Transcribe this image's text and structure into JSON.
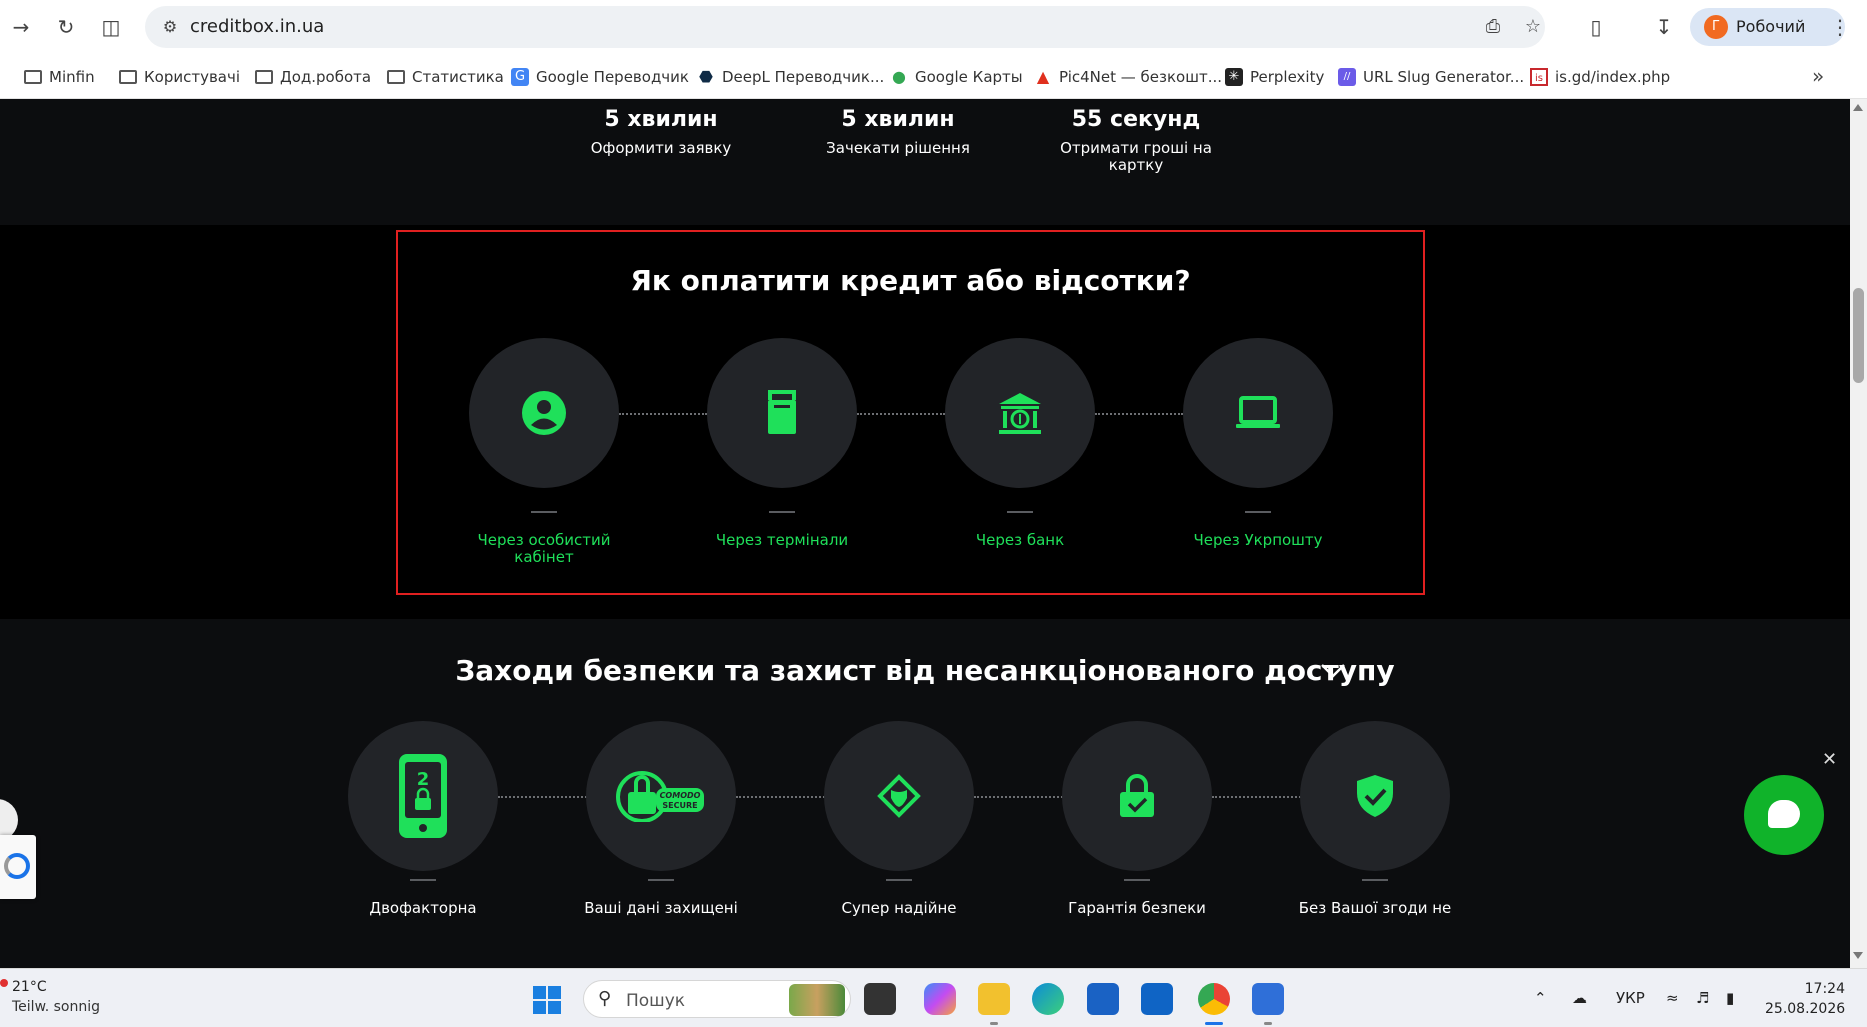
{
  "browser": {
    "url": "creditbox.in.ua",
    "profile_initial": "Г",
    "profile_name": "Робочий",
    "bookmarks": [
      {
        "label": "Minfin",
        "icon": "folder-icon"
      },
      {
        "label": "Користувачі",
        "icon": "folder-icon"
      },
      {
        "label": "Дод.робота",
        "icon": "folder-icon"
      },
      {
        "label": "Статистика",
        "icon": "folder-icon"
      },
      {
        "label": "Google Переводчик",
        "icon": "google-translate-icon"
      },
      {
        "label": "DeepL Переводчик...",
        "icon": "deepl-icon"
      },
      {
        "label": "Google Карты",
        "icon": "maps-pin-icon"
      },
      {
        "label": "Pic4Net — безкошт...",
        "icon": "pic4net-icon"
      },
      {
        "label": "Perplexity",
        "icon": "perplexity-icon"
      },
      {
        "label": "URL Slug Generator...",
        "icon": "url-slug-icon"
      },
      {
        "label": "is.gd/index.php",
        "icon": "isgd-icon"
      }
    ]
  },
  "stats": [
    {
      "value": "5 хвилин",
      "label": "Оформити заявку"
    },
    {
      "value": "5 хвилин",
      "label": "Зачекати рішення"
    },
    {
      "value": "55 секунд",
      "label": "Отримати гроші на картку"
    }
  ],
  "payment": {
    "title": "Як оплатити кредит або відсотки?",
    "steps": [
      {
        "label": "Через особистий кабінет",
        "icon": "user-account-icon"
      },
      {
        "label": "Через термінали",
        "icon": "terminal-icon"
      },
      {
        "label": "Через банк",
        "icon": "bank-icon"
      },
      {
        "label": "Через Укрпошту",
        "icon": "laptop-icon"
      }
    ]
  },
  "security": {
    "title": "Заходи безпеки та захист від несанкціонованого доступу",
    "items": [
      {
        "label": "Двофакторна",
        "icon": "phone-2fa-icon"
      },
      {
        "label": "Ваші дані захищені",
        "icon": "comodo-secure-icon",
        "badge_line1": "COMODO",
        "badge_line2": "SECURE"
      },
      {
        "label": "Супер надійне",
        "icon": "diamond-shield-icon"
      },
      {
        "label": "Гарантія безпеки",
        "icon": "padlock-check-icon"
      },
      {
        "label": "Без Вашої згоди не",
        "icon": "shield-check-icon"
      }
    ]
  },
  "taskbar": {
    "weather_temp": "21°C",
    "weather_desc": "Teilw. sonnig",
    "search_placeholder": "Пошук",
    "language": "УКР",
    "time": "17:24",
    "date": "25.08.2026"
  },
  "colors": {
    "accent_green": "#1fe05a",
    "highlight_border": "#e02020",
    "chat_green": "#10b32a"
  }
}
